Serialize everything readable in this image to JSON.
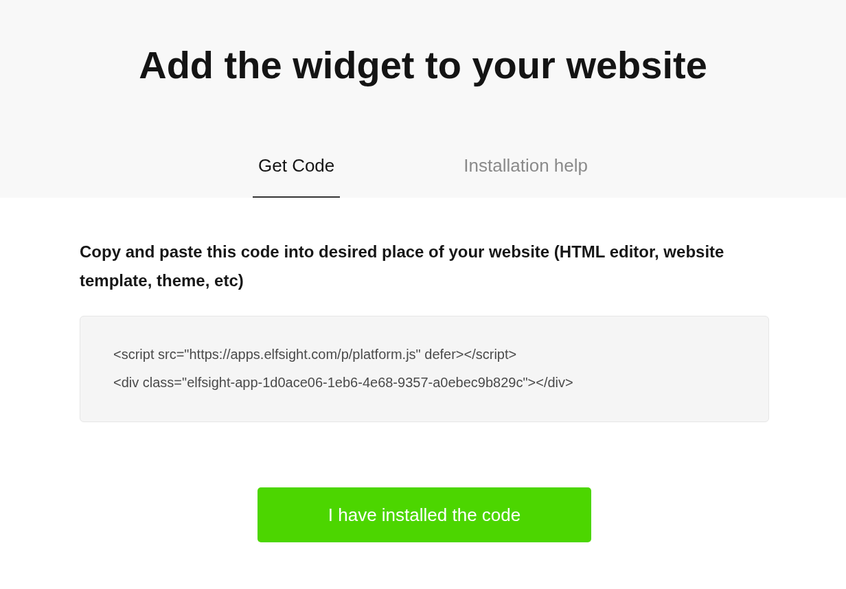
{
  "title": "Add the widget to your website",
  "tabs": [
    {
      "label": "Get Code",
      "selected": true
    },
    {
      "label": "Installation help",
      "selected": false
    }
  ],
  "instructions": "Copy and paste this code into desired place of your website (HTML editor, website template, theme, etc)",
  "code_lines": [
    "<script src=\"https://apps.elfsight.com/p/platform.js\" defer></script>",
    "<div class=\"elfsight-app-1d0ace06-1eb6-4e68-9357-a0ebec9b829c\"></div>"
  ],
  "button": "I have installed the code"
}
